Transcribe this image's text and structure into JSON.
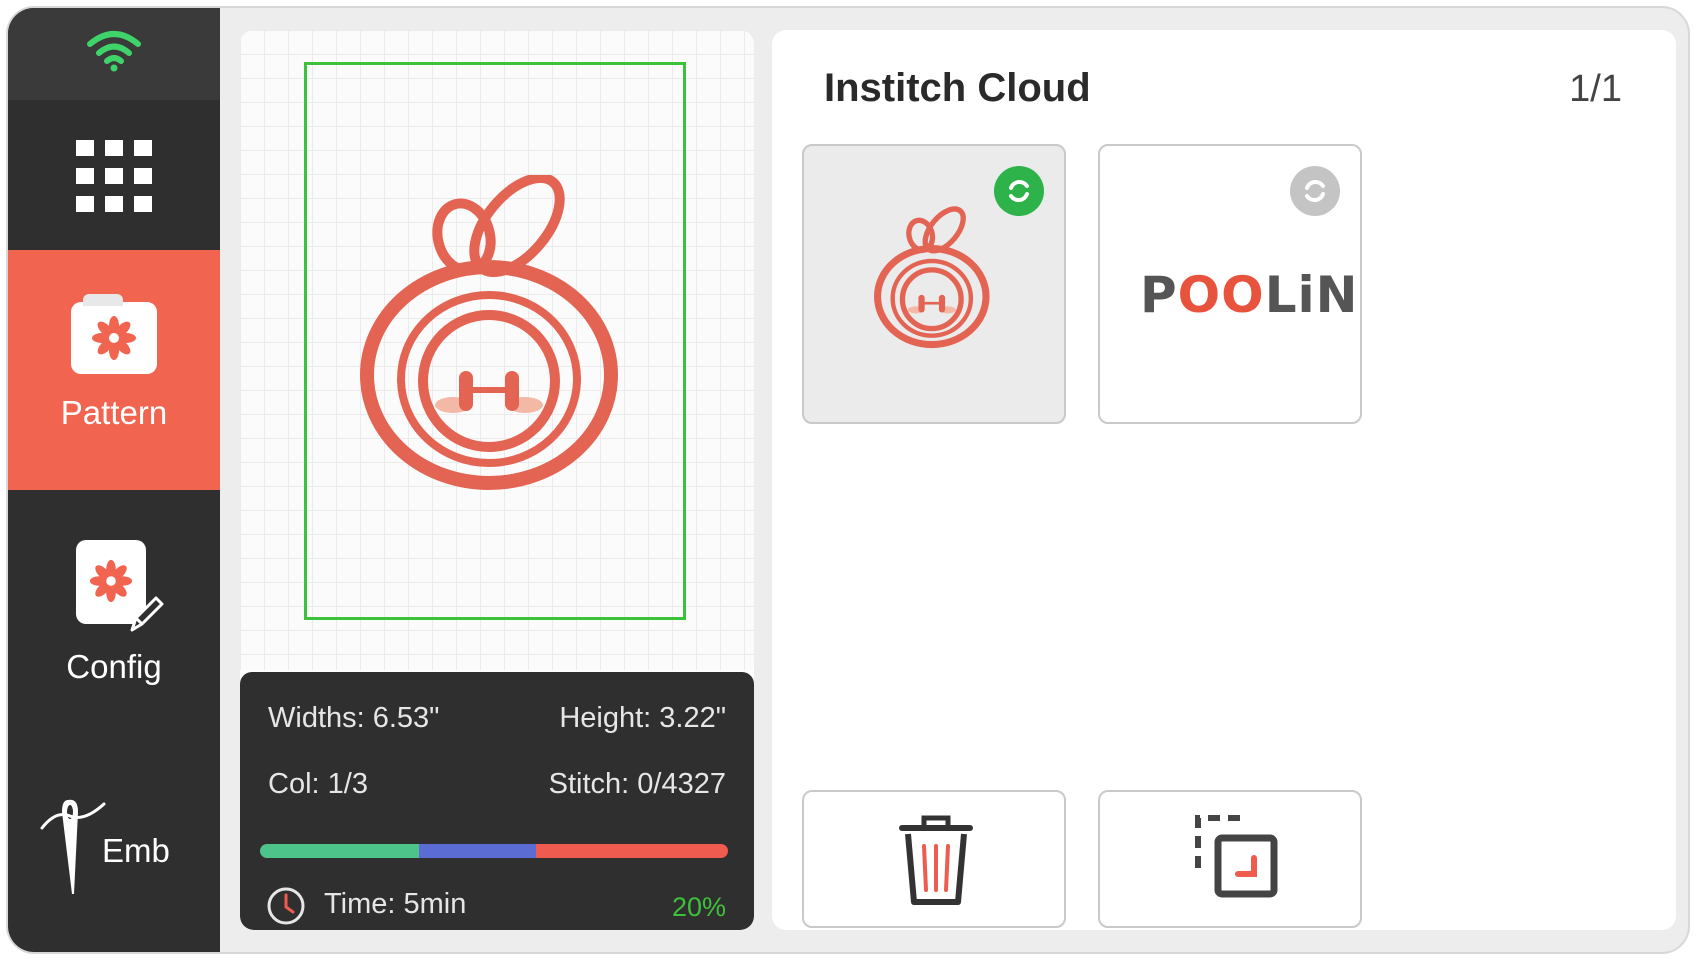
{
  "sidebar": {
    "wifi_icon": "wifi-icon",
    "apps_icon": "grid-apps-icon",
    "items": [
      {
        "label": "Pattern",
        "icon": "folder-flower-icon",
        "active": true
      },
      {
        "label": "Config",
        "icon": "flower-edit-icon",
        "active": false
      },
      {
        "label": "Emb",
        "icon": "needle-icon",
        "active": false
      }
    ]
  },
  "preview": {
    "widths": "Widths: 6.53\"",
    "height": "Height: 3.22\"",
    "col": "Col: 1/3",
    "stitch": "Stitch: 0/4327",
    "time": "Time: 5min",
    "percent": "20%",
    "progress_colors": [
      "#4cc48a",
      "#5b6cd4",
      "#ef5b4e"
    ],
    "progress_fractions": [
      0.34,
      0.25,
      0.41
    ]
  },
  "library": {
    "title": "Institch Cloud",
    "page": "1/1",
    "items": [
      {
        "name": "bunny-embroidery",
        "synced": true
      },
      {
        "name": "poolin-logo",
        "synced": false,
        "logo_text": [
          "P",
          "O",
          "O",
          "LiN"
        ]
      }
    ],
    "actions": {
      "delete_icon": "trash-icon",
      "copy_icon": "copy-icon"
    }
  },
  "colors": {
    "accent": "#f06450",
    "hoop": "#3cc13a",
    "sync_on": "#2db34a",
    "sync_off": "#c4c4c4",
    "sidebar_bg": "#2f2f2f"
  }
}
